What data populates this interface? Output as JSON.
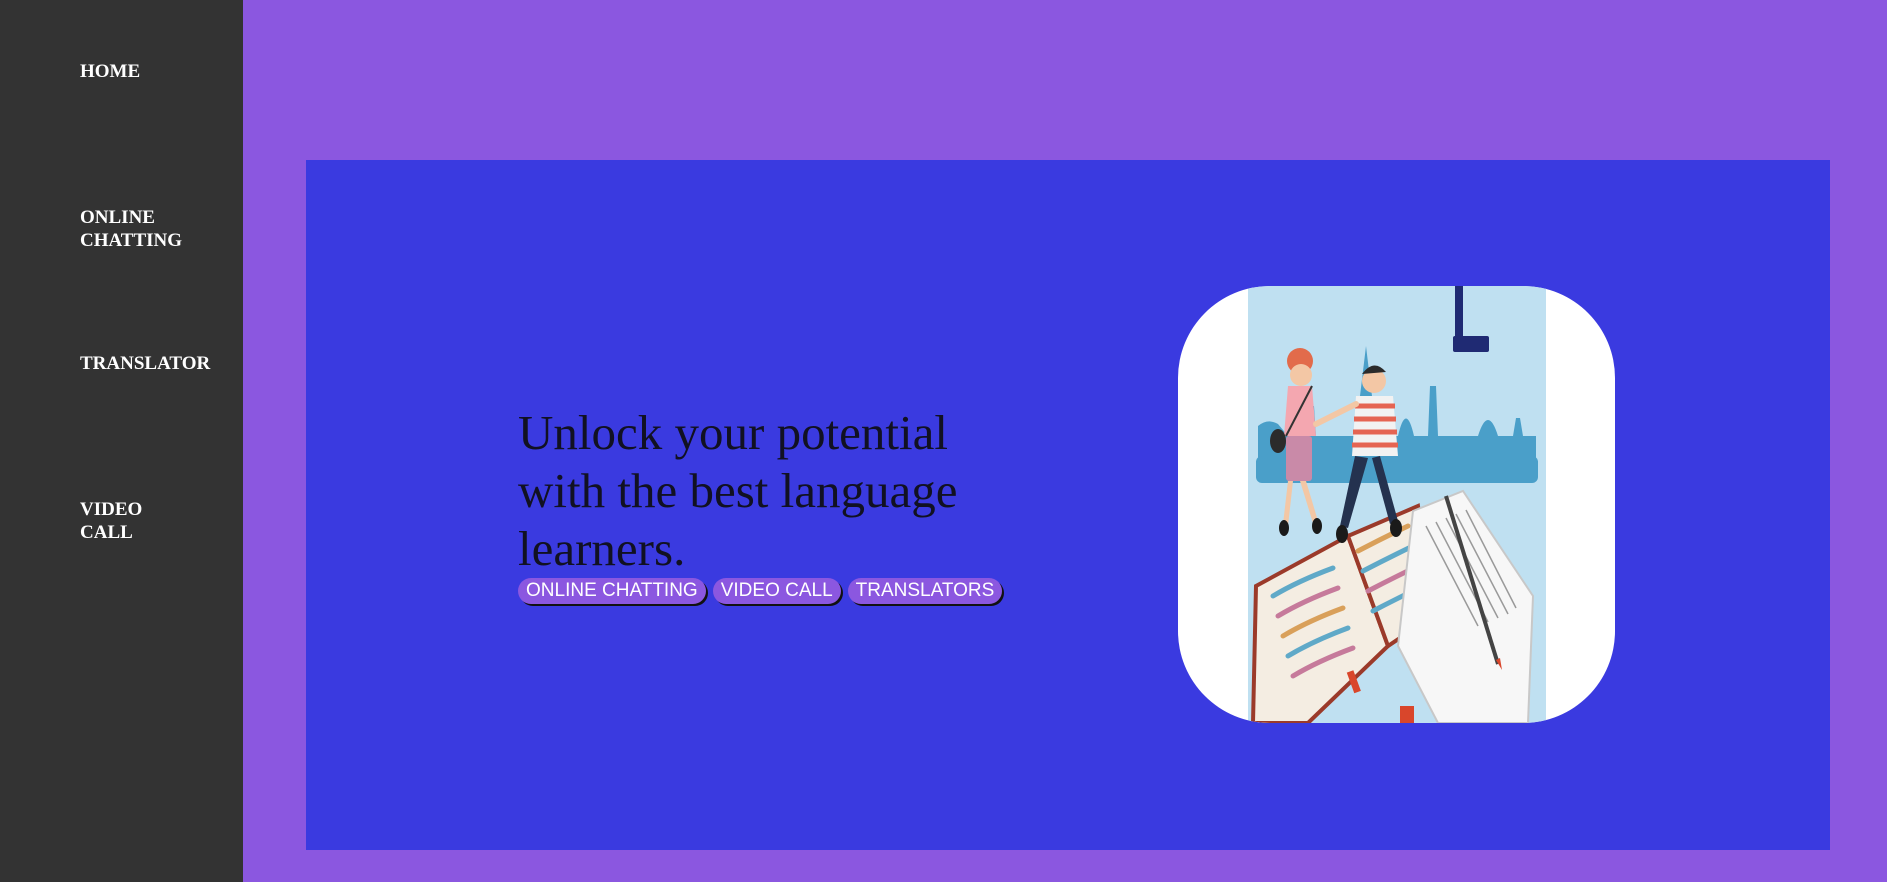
{
  "nav": {
    "home": "HOME",
    "online_chatting": "ONLINE CHATTING",
    "translator": "TRANSLATOR",
    "video_call": "VIDEO CALL"
  },
  "hero": {
    "headline": "Unlock your potential with the best language learners.",
    "buttons": {
      "online_chatting": "ONLINE CHATTING",
      "video_call": "VIDEO CALL",
      "translators": "TRANSLATORS"
    }
  },
  "colors": {
    "page_background": "#8b57e0",
    "sidebar": "#333333",
    "hero_panel": "#3a3ae0",
    "pill": "#8b57e0"
  },
  "icons": {
    "hero_image": "language-learners-illustration"
  }
}
